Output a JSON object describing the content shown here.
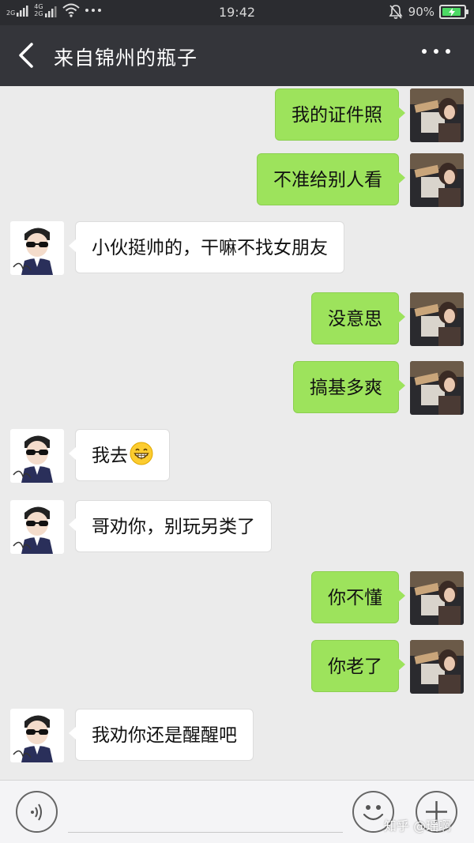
{
  "status_bar": {
    "time": "19:42",
    "network_top": "2G",
    "network_mid_top": "4G",
    "network_mid_bottom": "2G",
    "battery": "90%",
    "battery_level": 0.9
  },
  "header": {
    "title": "来自锦州的瓶子"
  },
  "messages": [
    {
      "sender": "me",
      "text": "我的证件照"
    },
    {
      "sender": "me",
      "text": "不准给别人看"
    },
    {
      "sender": "them",
      "text": "小伙挺帅的，干嘛不找女朋友"
    },
    {
      "sender": "me",
      "text": "没意思"
    },
    {
      "sender": "me",
      "text": "搞基多爽"
    },
    {
      "sender": "them",
      "text": "我去",
      "emoji": "grinning-face"
    },
    {
      "sender": "them",
      "text": "哥劝你，别玩另类了"
    },
    {
      "sender": "me",
      "text": "你不懂"
    },
    {
      "sender": "me",
      "text": "你老了"
    },
    {
      "sender": "them",
      "text": "我劝你还是醒醒吧"
    }
  ],
  "input_bar": {
    "voice_icon": "voice-icon",
    "emoji_icon": "emoji-icon",
    "plus_icon": "plus-icon"
  },
  "watermark": "知乎 @瑶啊",
  "colors": {
    "my_bubble": "#9de35c",
    "their_bubble": "#ffffff",
    "header_bg": "#34353a",
    "chat_bg": "#ebebeb"
  }
}
